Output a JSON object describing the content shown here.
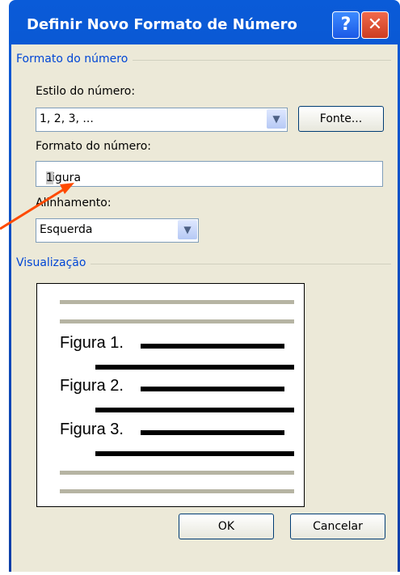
{
  "window": {
    "title": "Definir Novo Formato de Número"
  },
  "group_format": {
    "title": "Formato do número",
    "style_label": "Estilo do número:",
    "style_value": "1, 2, 3, ...",
    "font_button": "Fonte...",
    "format_label": "Formato do número:",
    "format_value_prefix": "Figura ",
    "format_value_highlight": "1",
    "format_value_suffix": ".",
    "align_label": "Alinhamento:",
    "align_value": "Esquerda"
  },
  "group_preview": {
    "title": "Visualização",
    "items": [
      "Figura 1.",
      "Figura 2.",
      "Figura 3."
    ]
  },
  "buttons": {
    "ok": "OK",
    "cancel": "Cancelar"
  },
  "icons": {
    "help": "?",
    "close": "✕",
    "dropdown": "▼"
  }
}
